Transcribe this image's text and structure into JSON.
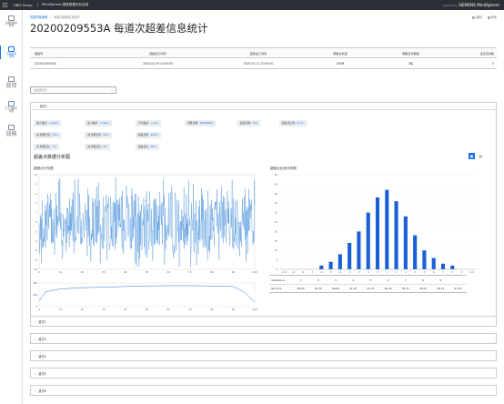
{
  "topbar": {
    "org": "HBIS Group",
    "app_title": "MindSphere 钢铁数据分析应用",
    "brand_prefix": "powered by",
    "brand": "SIEMENS MindSphere"
  },
  "sidebar": {
    "items": [
      {
        "label": "设备和制造\n管理",
        "active": false
      },
      {
        "label": "轧辊质量\n管理",
        "active": true
      },
      {
        "label": "钢材 建模\n趋势 分析",
        "active": false
      },
      {
        "label": "工艺 规格与\n管理",
        "active": false
      },
      {
        "label": "轧机 跟踪\n追溯 管理",
        "active": false
      }
    ]
  },
  "breadcrumb": {
    "root": "轧辊质量管理",
    "current": "每道次超差信息统计"
  },
  "tools": {
    "back": "返回",
    "close": "关闭"
  },
  "page_title": "20200209553A 每道次超差信息统计",
  "info_table": {
    "columns": [
      "钢板号",
      "起始加工时间",
      "结束加工时间",
      "钢板总长度",
      "钢板道次数量",
      "设定道次数"
    ],
    "row": [
      "20200209553A",
      "2020-02-09 10:00:00",
      "2020-02-12 10:00:00",
      "500M",
      "5吨",
      "5"
    ]
  },
  "filter": {
    "placeholder": "请选择道次"
  },
  "panel1": {
    "header": "道次1",
    "chips": [
      {
        "label": "最大差值:",
        "value": "+15μm"
      },
      {
        "label": "最小差值:",
        "value": "+15μm"
      },
      {
        "label": "平均差值:",
        "value": "+1μm"
      },
      {
        "label": "测量点数:",
        "value": "20000000"
      },
      {
        "label": "超差点数:",
        "value": "200"
      },
      {
        "label": "超差点比例:",
        "value": "0.1%"
      },
      {
        "label": "加 测量长度:",
        "value": "50m"
      },
      {
        "label": "减 测量长度:",
        "value": "50m"
      },
      {
        "label": "超差长度:",
        "value": "400m"
      },
      {
        "label": "加 测量点比:",
        "value": "1%"
      },
      {
        "label": "减 测量点比:",
        "value": "1%"
      },
      {
        "label": "超差点比:",
        "value": "98%"
      }
    ],
    "section_title": "超差点数据分析图",
    "left_chart_title": "超差点分布图",
    "right_chart_title": "超差点比例分布图"
  },
  "chart_data": [
    {
      "type": "line",
      "title": "超差点分布图",
      "x_range": [
        0,
        100
      ],
      "y_range": [
        -10,
        10
      ],
      "xticks": [
        0,
        10,
        20,
        30,
        40,
        50,
        60,
        70,
        80,
        90,
        100
      ],
      "yticks": [
        10,
        8,
        6,
        4,
        2,
        0,
        -2,
        -4,
        -6,
        -8,
        -10
      ],
      "description_values": "dense noise oscillating roughly between -8 and 8 across x 0-100"
    },
    {
      "type": "area",
      "x_range": [
        0,
        100
      ],
      "yticks": [
        400,
        200,
        0
      ],
      "x": [
        0,
        3,
        10,
        20,
        30,
        40,
        50,
        60,
        70,
        80,
        90,
        95,
        100
      ],
      "values": [
        100,
        250,
        300,
        320,
        330,
        340,
        350,
        355,
        355,
        350,
        340,
        250,
        80
      ],
      "xticks": [
        0,
        10,
        20,
        30,
        40,
        50,
        60,
        70,
        80,
        90,
        100
      ]
    },
    {
      "type": "bar",
      "title": "超差点比例分布图",
      "categories": [
        "<-10",
        "-9",
        "-8",
        "-7",
        "-6",
        "-5",
        "-4",
        "-3",
        "-2",
        "-1",
        "0",
        "1",
        "2",
        "3",
        "4",
        "5",
        "6",
        "7",
        "8",
        "9",
        ">10"
      ],
      "values": [
        0,
        0,
        0,
        0,
        2,
        4,
        8,
        14,
        20,
        30,
        38,
        42,
        36,
        28,
        18,
        10,
        6,
        3,
        2,
        0,
        0
      ],
      "yticks": [
        50,
        45,
        40,
        35,
        30,
        25,
        20,
        15,
        10,
        5,
        0
      ],
      "ylim": [
        0,
        50
      ]
    }
  ],
  "deviation_table": {
    "head": [
      "deviation↔",
      "1",
      "2",
      "3",
      "4",
      "5",
      "6",
      "7",
      "8",
      "9"
    ],
    "row": [
      "len(%)%",
      "49.84",
      "67.35",
      "80.06",
      "91.23",
      "93.33",
      "94.32",
      "95.11",
      "95.67",
      "96.12",
      "97.33",
      "97.45"
    ]
  },
  "folded_panels": [
    "道次2",
    "道次3",
    "道次4",
    "道次5",
    "道次6"
  ]
}
